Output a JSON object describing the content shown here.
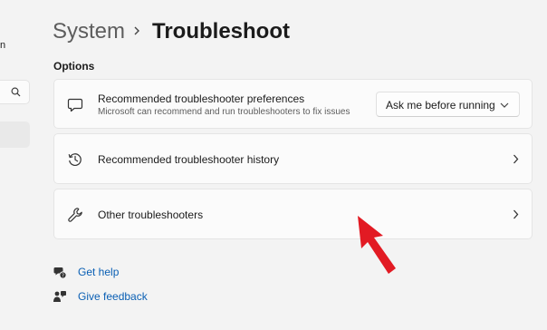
{
  "sidebar": {
    "truncated_text": "n"
  },
  "breadcrumb": {
    "parent": "System",
    "current": "Troubleshoot"
  },
  "section": {
    "title": "Options"
  },
  "cards": {
    "preferences": {
      "title": "Recommended troubleshooter preferences",
      "subtitle": "Microsoft can recommend and run troubleshooters to fix issues",
      "dropdown_value": "Ask me before running",
      "icon": "chat-bubble-icon"
    },
    "history": {
      "title": "Recommended troubleshooter history",
      "icon": "history-icon"
    },
    "other": {
      "title": "Other troubleshooters",
      "icon": "wrench-icon"
    }
  },
  "links": {
    "get_help": "Get help",
    "give_feedback": "Give feedback"
  },
  "colors": {
    "link": "#0a5fb4",
    "annotation_arrow": "#e21a23",
    "background": "#f3f3f3",
    "card": "#fbfbfb"
  }
}
